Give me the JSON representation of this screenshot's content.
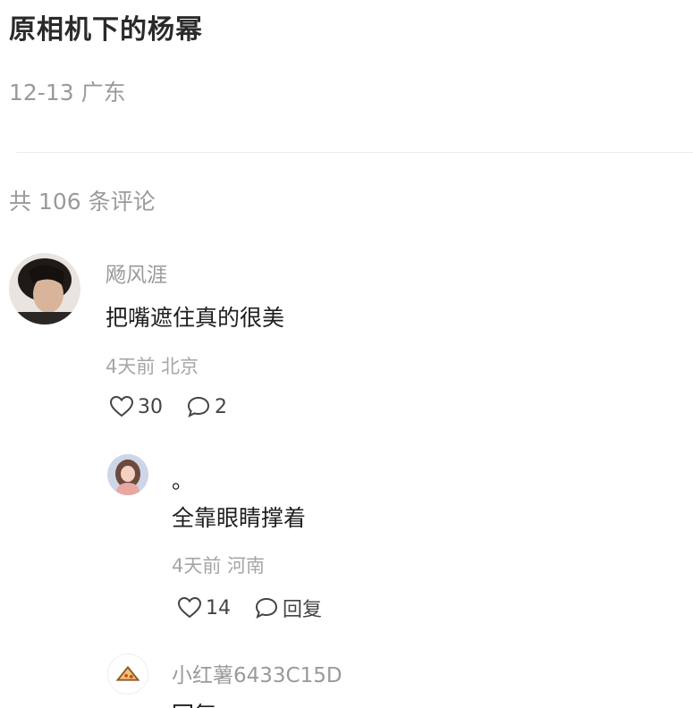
{
  "post": {
    "title": "原相机下的杨幂",
    "meta": "12-13 广东"
  },
  "comments_header": "共 106 条评论",
  "comments": [
    {
      "username": "飏风涯",
      "content": "把嘴遮住真的很美",
      "time_location": "4天前 北京",
      "likes": "30",
      "replies": "2",
      "avatar_icon": "user-photo-avatar"
    }
  ],
  "replies": [
    {
      "username": "。",
      "content": "全靠眼睛撑着",
      "time_location": "4天前 河南",
      "likes": "14",
      "reply_label": "回复",
      "avatar_icon": "cartoon-girl-avatar"
    },
    {
      "username": "小红薯6433C15D",
      "content": "回复",
      "avatar_icon": "pizza-avatar"
    }
  ],
  "colors": {
    "muted": "#9a9a9a",
    "text": "#1f1f1f"
  }
}
